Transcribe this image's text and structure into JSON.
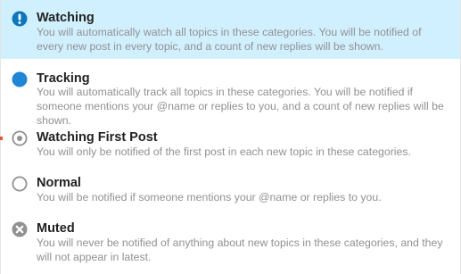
{
  "menu": {
    "items": [
      {
        "icon": "exclamation-circle-icon",
        "title": "Watching",
        "description": "You will automatically watch all topics in these categories. You will be notified of every new post in every topic, and a count of new replies will be shown."
      },
      {
        "icon": "filled-circle-icon",
        "title": "Tracking",
        "description": "You will automatically track all topics in these categories. You will be notified if someone mentions your @name or replies to you, and a count of new replies will be shown."
      },
      {
        "icon": "dot-circle-icon",
        "title": "Watching First Post",
        "description": "You will only be notified of the first post in each new topic in these categories."
      },
      {
        "icon": "empty-circle-icon",
        "title": "Normal",
        "description": "You will be notified if someone mentions your @name or replies to you."
      },
      {
        "icon": "times-circle-icon",
        "title": "Muted",
        "description": "You will never be notified of anything about new topics in these categories, and they will not appear in latest."
      }
    ],
    "selected_index": 0
  },
  "colors": {
    "selected_background": "#d1f0ff",
    "watching_icon": "#0e76bd",
    "tracking_icon": "#1f85d4",
    "neutral_icon": "#919191",
    "title_text": "#222222",
    "description_text": "#919191"
  }
}
